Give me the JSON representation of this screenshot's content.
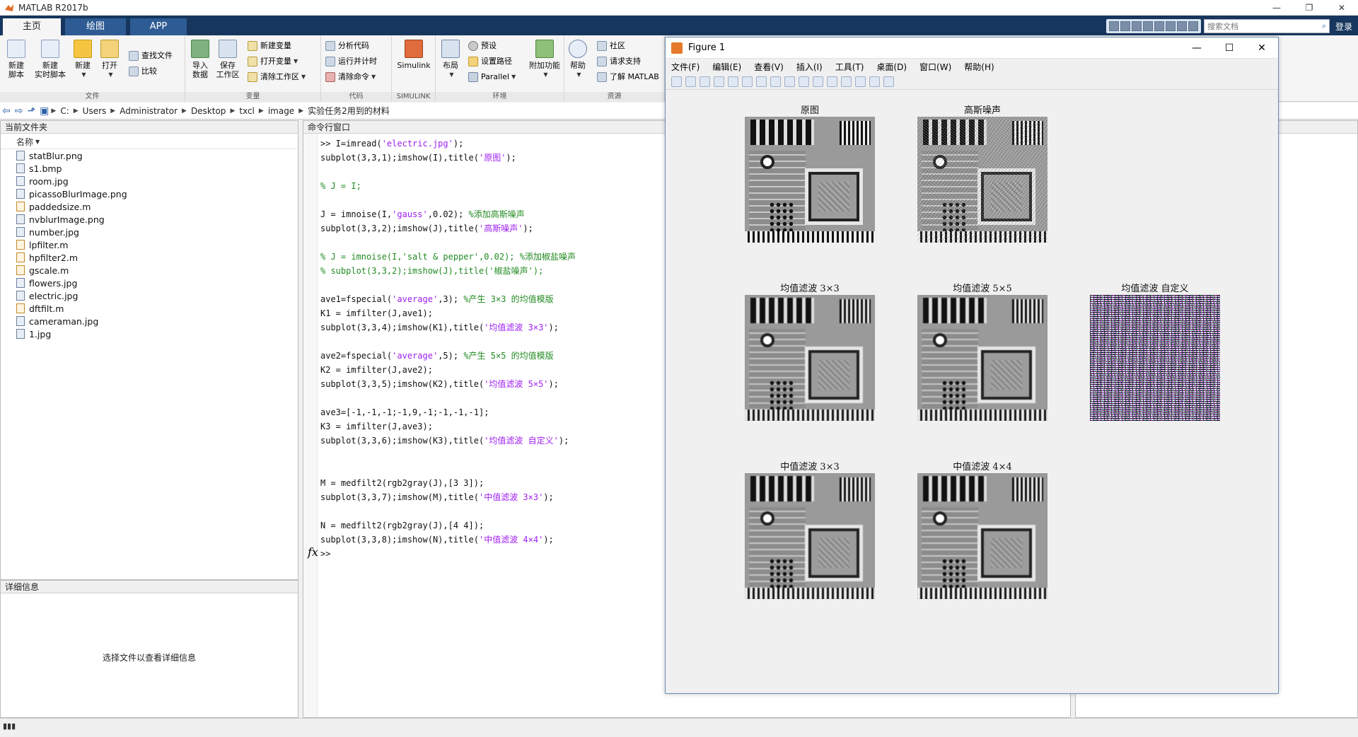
{
  "app": {
    "title": "MATLAB R2017b"
  },
  "window_controls": {
    "minimize": "—",
    "restore": "❐",
    "close": "✕"
  },
  "tabs": [
    {
      "label": "主页",
      "active": true
    },
    {
      "label": "绘图",
      "active": false
    },
    {
      "label": "APP",
      "active": false
    }
  ],
  "search": {
    "placeholder": "搜索文档",
    "login": "登录"
  },
  "ribbon": {
    "file": {
      "label": "文件",
      "new_script": "新建\n脚本",
      "new_live_script": "新建\n实时脚本",
      "new": "新建",
      "open": "打开",
      "find_files": "查找文件",
      "compare": "比较"
    },
    "variable": {
      "label": "变量",
      "import_data": "导入\n数据",
      "save_workspace": "保存\n工作区",
      "new_variable": "新建变量",
      "open_variable": "打开变量",
      "clear_workspace": "清除工作区"
    },
    "code": {
      "label": "代码",
      "analyze_code": "分析代码",
      "run_and_time": "运行并计时",
      "clear_commands": "清除命令"
    },
    "simulink": {
      "label": "SIMULINK",
      "simulink": "Simulink"
    },
    "environment": {
      "label": "环境",
      "layout": "布局",
      "preferences": "预设",
      "set_path": "设置路径",
      "parallel": "Parallel",
      "addons": "附加功能"
    },
    "resources": {
      "label": "资源",
      "help": "帮助",
      "community": "社区",
      "request_support": "请求支持",
      "learn_matlab": "了解 MATLAB"
    }
  },
  "path": {
    "segments": [
      "C:",
      "Users",
      "Administrator",
      "Desktop",
      "txcl",
      "image",
      "实验任务2用到的材料"
    ]
  },
  "file_panel": {
    "title": "当前文件夹",
    "column_name": "名称",
    "files": [
      {
        "name": "statBlur.png",
        "type": "img"
      },
      {
        "name": "s1.bmp",
        "type": "img"
      },
      {
        "name": "room.jpg",
        "type": "img"
      },
      {
        "name": "picassoBlurImage.png",
        "type": "img"
      },
      {
        "name": "paddedsize.m",
        "type": "m"
      },
      {
        "name": "nvblurImage.png",
        "type": "img"
      },
      {
        "name": "number.jpg",
        "type": "img"
      },
      {
        "name": "lpfilter.m",
        "type": "m"
      },
      {
        "name": "hpfilter2.m",
        "type": "m"
      },
      {
        "name": "gscale.m",
        "type": "m"
      },
      {
        "name": "flowers.jpg",
        "type": "img"
      },
      {
        "name": "electric.jpg",
        "type": "img"
      },
      {
        "name": "dftfilt.m",
        "type": "m"
      },
      {
        "name": "cameraman.jpg",
        "type": "img"
      },
      {
        "name": "1.jpg",
        "type": "img"
      }
    ]
  },
  "detail_panel": {
    "title": "详细信息",
    "message": "选择文件以查看详细信息"
  },
  "command_window": {
    "title": "命令行窗口",
    "lines": [
      {
        "code": ">> I=imread(",
        "str": "'electric.jpg'",
        "tail": ");"
      },
      {
        "code": "subplot(3,3,1);imshow(I),title(",
        "str": "'原图'",
        "tail": ");"
      },
      {
        "code": "",
        "str": "",
        "tail": ""
      },
      {
        "code": "",
        "str": "",
        "tail": "",
        "comment": "% J = I;"
      },
      {
        "code": "",
        "str": "",
        "tail": ""
      },
      {
        "code": "J = imnoise(I,",
        "str": "'gauss'",
        "tail": ",0.02); ",
        "comment": "%添加高斯噪声"
      },
      {
        "code": "subplot(3,3,2);imshow(J),title(",
        "str": "'高斯噪声'",
        "tail": ");"
      },
      {
        "code": "",
        "str": "",
        "tail": ""
      },
      {
        "code": "",
        "str": "",
        "tail": "",
        "comment": "% J = imnoise(I,'salt & pepper',0.02); %添加椒盐噪声"
      },
      {
        "code": "",
        "str": "",
        "tail": "",
        "comment": "% subplot(3,3,2);imshow(J),title('椒盐噪声');"
      },
      {
        "code": "",
        "str": "",
        "tail": ""
      },
      {
        "code": "ave1=fspecial(",
        "str": "'average'",
        "tail": ",3); ",
        "comment": "%产生 3×3 的均值模版"
      },
      {
        "code": "K1 = imfilter(J,ave1);",
        "str": "",
        "tail": ""
      },
      {
        "code": "subplot(3,3,4);imshow(K1),title(",
        "str": "'均值滤波 3×3'",
        "tail": ");"
      },
      {
        "code": "",
        "str": "",
        "tail": ""
      },
      {
        "code": "ave2=fspecial(",
        "str": "'average'",
        "tail": ",5); ",
        "comment": "%产生 5×5 的均值模版"
      },
      {
        "code": "K2 = imfilter(J,ave2);",
        "str": "",
        "tail": ""
      },
      {
        "code": "subplot(3,3,5);imshow(K2),title(",
        "str": "'均值滤波 5×5'",
        "tail": ");"
      },
      {
        "code": "",
        "str": "",
        "tail": ""
      },
      {
        "code": "ave3=[-1,-1,-1;-1,9,-1;-1,-1,-1];",
        "str": "",
        "tail": ""
      },
      {
        "code": "K3 = imfilter(J,ave3);",
        "str": "",
        "tail": ""
      },
      {
        "code": "subplot(3,3,6);imshow(K3),title(",
        "str": "'均值滤波 自定义'",
        "tail": ");"
      },
      {
        "code": "",
        "str": "",
        "tail": ""
      },
      {
        "code": "",
        "str": "",
        "tail": ""
      },
      {
        "code": "M = medfilt2(rgb2gray(J),[3 3]);",
        "str": "",
        "tail": ""
      },
      {
        "code": "subplot(3,3,7);imshow(M),title(",
        "str": "'中值滤波 3×3'",
        "tail": ");"
      },
      {
        "code": "",
        "str": "",
        "tail": ""
      },
      {
        "code": "N = medfilt2(rgb2gray(J),[4 4]);",
        "str": "",
        "tail": ""
      },
      {
        "code": "subplot(3,3,8);imshow(N),title(",
        "str": "'中值滤波 4×4'",
        "tail": ");"
      },
      {
        "code": ">>",
        "str": "",
        "tail": ""
      }
    ],
    "fx": "fx"
  },
  "figure": {
    "title": "Figure 1",
    "menu": [
      "文件(F)",
      "编辑(E)",
      "查看(V)",
      "插入(I)",
      "工具(T)",
      "桌面(D)",
      "窗口(W)",
      "帮助(H)"
    ],
    "subplots": [
      {
        "title": "原图",
        "variant": "clean"
      },
      {
        "title": "高斯噪声",
        "variant": "noise"
      },
      {
        "title": "均值滤波 3×3",
        "variant": "blur"
      },
      {
        "title": "均值滤波 5×5",
        "variant": "blur"
      },
      {
        "title": "均值滤波 自定义",
        "variant": "custom"
      },
      {
        "title": "中值滤波 3×3",
        "variant": "blur"
      },
      {
        "title": "中值滤波 4×4",
        "variant": "blur"
      }
    ]
  },
  "colors": {
    "tabstrip": "#16365d",
    "string": "#a020f0",
    "comment": "#228b22"
  }
}
